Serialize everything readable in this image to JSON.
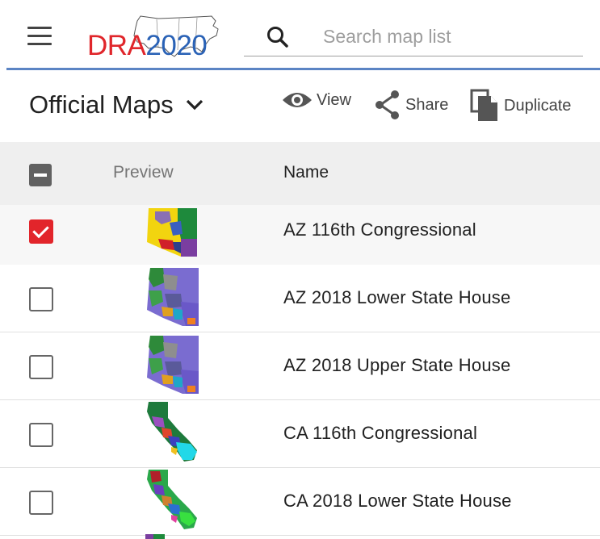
{
  "header": {
    "logo_prefix": "DRA",
    "logo_year": "2020",
    "search_placeholder": "Search map list"
  },
  "toolbar": {
    "map_list_title": "Official Maps",
    "view_label": "View",
    "share_label": "Share",
    "duplicate_label": "Duplicate"
  },
  "table": {
    "columns": {
      "preview": "Preview",
      "name": "Name"
    },
    "rows": [
      {
        "name": "AZ 116th Congressional",
        "checked": true,
        "state": "AZ"
      },
      {
        "name": "AZ 2018 Lower State House",
        "checked": false,
        "state": "AZ"
      },
      {
        "name": "AZ 2018 Upper State House",
        "checked": false,
        "state": "AZ"
      },
      {
        "name": "CA 116th Congressional",
        "checked": false,
        "state": "CA"
      },
      {
        "name": "CA 2018 Lower State House",
        "checked": false,
        "state": "CA"
      }
    ]
  },
  "colors": {
    "accent_red": "#e2252b",
    "brand_blue": "#2a62b6",
    "header_rule": "#5b84c4"
  }
}
